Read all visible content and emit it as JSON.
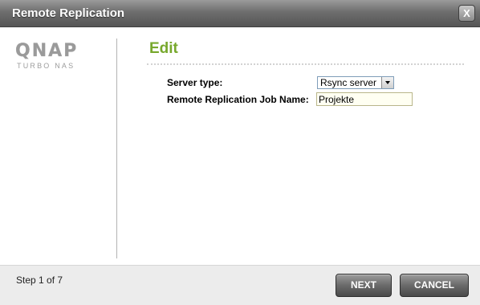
{
  "window": {
    "title": "Remote Replication",
    "close_label": "X"
  },
  "logo": {
    "brand": "QNAP",
    "tagline": "Turbo NAS"
  },
  "form": {
    "heading": "Edit",
    "server_type_label": "Server type:",
    "server_type_value": "Rsync server",
    "job_name_label": "Remote Replication Job Name:",
    "job_name_value": "Projekte"
  },
  "footer": {
    "step_text": "Step 1 of 7",
    "next_label": "NEXT",
    "cancel_label": "CANCEL"
  },
  "colors": {
    "heading_green": "#77a82c",
    "titlebar": "#6e6e6e"
  }
}
